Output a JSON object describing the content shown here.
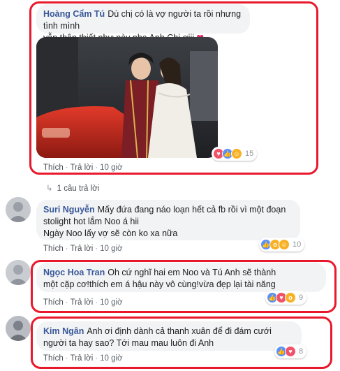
{
  "comments": [
    {
      "author": "Hoàng Cẩm Tú",
      "text_line1": "Dù chị có là vợ người ta rồi nhưng tình mình",
      "text_line2": "vẫn thân thiết như này nha Anh Chị ơiii",
      "like": "Thích",
      "reply": "Trả lời",
      "time": "10 giờ",
      "reaction_count": "15",
      "reactions": [
        "heart-reaction",
        "like-reaction",
        "haha-reaction"
      ],
      "heart_emoji": "❤"
    },
    {
      "author": "Suri Nguyễn",
      "text_line1": "Mấy đứa đang náo loạn hết cả fb rồi vì một đoạn",
      "text_line2": "stolight hot lắm Noo á hii",
      "text_line3": "Ngày Noo lấy vợ sẽ còn ko xa nữa",
      "like": "Thích",
      "reply": "Trả lời",
      "time": "10 giờ",
      "reaction_count": "10"
    },
    {
      "author": "Ngọc Hoa Tran",
      "text_line1": "Oh cứ nghĩ hai em Noo và Tú Anh sẽ thành",
      "text_line2": "một cặp cơ!thích em á hậu này vô cùng!vừa đẹp lại tài năng",
      "like": "Thích",
      "reply": "Trả lời",
      "time": "10 giờ",
      "reaction_count": "9"
    },
    {
      "author": "Kim Ngân",
      "text_line1": "Anh ơi định dành cả thanh xuân để đi đám cưới",
      "text_line2": "người ta hay sao? Tới mau mau luôn đi Anh",
      "like": "Thích",
      "reply": "Trả lời",
      "time": "10 giờ",
      "reaction_count": "8"
    }
  ],
  "replies_link": "1 câu trả lời",
  "colors": {
    "name": "#385898",
    "highlight": "#e8192c",
    "bubble": "#f2f3f5"
  }
}
